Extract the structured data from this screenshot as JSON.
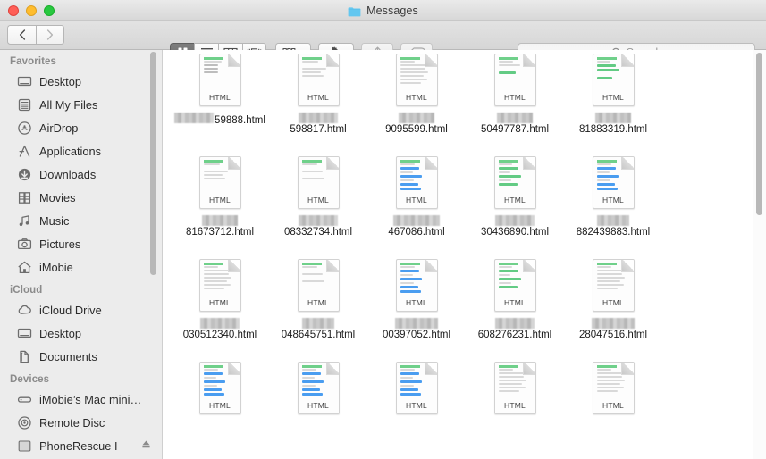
{
  "window": {
    "title": "Messages",
    "folder_icon": "folder-icon",
    "traffic_lights": [
      "close",
      "minimize",
      "zoom"
    ]
  },
  "toolbar": {
    "back_label": "Back",
    "forward_label": "Forward",
    "view_modes": [
      {
        "name": "icon-view",
        "label": "Icon View",
        "active": true
      },
      {
        "name": "list-view",
        "label": "List View",
        "active": false
      },
      {
        "name": "column-view",
        "label": "Column View",
        "active": false
      },
      {
        "name": "coverflow-view",
        "label": "Cover Flow View",
        "active": false
      }
    ],
    "arrange_label": "Arrange By",
    "action_label": "Action",
    "share_label": "Share",
    "tag_label": "Edit Tags"
  },
  "search": {
    "placeholder": "Search",
    "value": ""
  },
  "sidebar": {
    "sections": [
      {
        "title": "Favorites",
        "items": [
          {
            "label": "Desktop",
            "icon": "desktop-icon"
          },
          {
            "label": "All My Files",
            "icon": "all-my-files-icon"
          },
          {
            "label": "AirDrop",
            "icon": "airdrop-icon"
          },
          {
            "label": "Applications",
            "icon": "applications-icon"
          },
          {
            "label": "Downloads",
            "icon": "downloads-icon"
          },
          {
            "label": "Movies",
            "icon": "movies-icon"
          },
          {
            "label": "Music",
            "icon": "music-icon"
          },
          {
            "label": "Pictures",
            "icon": "pictures-icon"
          },
          {
            "label": "iMobie",
            "icon": "home-icon"
          }
        ]
      },
      {
        "title": "iCloud",
        "items": [
          {
            "label": "iCloud Drive",
            "icon": "icloud-drive-icon"
          },
          {
            "label": "Desktop",
            "icon": "desktop-icon"
          },
          {
            "label": "Documents",
            "icon": "documents-icon"
          }
        ]
      },
      {
        "title": "Devices",
        "items": [
          {
            "label": "iMobie’s Mac mini…",
            "icon": "mac-mini-icon"
          },
          {
            "label": "Remote Disc",
            "icon": "remote-disc-icon"
          },
          {
            "label": "PhoneRescue I",
            "icon": "external-drive-icon",
            "eject": true
          }
        ]
      }
    ]
  },
  "files": [
    {
      "redacted_width": 44,
      "name": "59888.html",
      "kind": "HTML",
      "thumb": "text-block"
    },
    {
      "redacted_width": 44,
      "name": "598817.html",
      "kind": "HTML",
      "thumb": "lines-short"
    },
    {
      "redacted_width": 40,
      "name": "9095599.html",
      "kind": "HTML",
      "thumb": "lines-many"
    },
    {
      "redacted_width": 40,
      "name": "50497787.html",
      "kind": "HTML",
      "thumb": "green-box"
    },
    {
      "redacted_width": 40,
      "name": "81883319.html",
      "kind": "HTML",
      "thumb": "green-bars"
    },
    {
      "redacted_width": 40,
      "name": "81673712.html",
      "kind": "HTML",
      "thumb": "lines-short"
    },
    {
      "redacted_width": 44,
      "name": "08332734.html",
      "kind": "HTML",
      "thumb": "lines-sparse"
    },
    {
      "redacted_width": 52,
      "name": "467086.html",
      "kind": "HTML",
      "thumb": "blue-lines"
    },
    {
      "redacted_width": 44,
      "name": "30436890.html",
      "kind": "HTML",
      "thumb": "green-lines"
    },
    {
      "redacted_width": 36,
      "name": "882439883.html",
      "kind": "HTML",
      "thumb": "blue-lines"
    },
    {
      "redacted_width": 44,
      "name": "030512340.html",
      "kind": "HTML",
      "thumb": "lines-many"
    },
    {
      "redacted_width": 36,
      "name": "048645751.html",
      "kind": "HTML",
      "thumb": "lines-sparse"
    },
    {
      "redacted_width": 48,
      "name": "00397052.html",
      "kind": "HTML",
      "thumb": "blue-lines"
    },
    {
      "redacted_width": 44,
      "name": "608276231.html",
      "kind": "HTML",
      "thumb": "green-lines"
    },
    {
      "redacted_width": 48,
      "name": "28047516.html",
      "kind": "HTML",
      "thumb": "lines-many"
    },
    {
      "redacted_width": 0,
      "name": "",
      "kind": "HTML",
      "thumb": "blue-lines"
    },
    {
      "redacted_width": 0,
      "name": "",
      "kind": "HTML",
      "thumb": "blue-lines"
    },
    {
      "redacted_width": 0,
      "name": "",
      "kind": "HTML",
      "thumb": "blue-lines"
    },
    {
      "redacted_width": 0,
      "name": "",
      "kind": "HTML",
      "thumb": "lines-many"
    },
    {
      "redacted_width": 0,
      "name": "",
      "kind": "HTML",
      "thumb": "lines-many"
    }
  ],
  "colors": {
    "folder_blue": "#63c7f0",
    "accent_green": "#6fd08a",
    "accent_blue": "#4a9df0",
    "titlebar": "#e2e2e2",
    "sidebar_bg": "#ececec"
  }
}
